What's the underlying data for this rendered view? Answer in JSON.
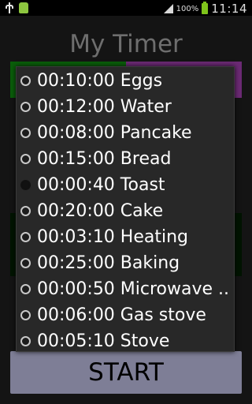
{
  "status_bar": {
    "battery": "100%",
    "time": "11:14"
  },
  "app": {
    "title": "My Timer",
    "start_label": "START"
  },
  "colors": {
    "tab_green": "#0a5e0a",
    "tab_purple": "#6b2a74",
    "start_button": "#7e7e96"
  },
  "dropdown": {
    "items": [
      {
        "label": "00:10:00 Eggs",
        "selected": false
      },
      {
        "label": "00:12:00 Water",
        "selected": false
      },
      {
        "label": "00:08:00 Pancake",
        "selected": false
      },
      {
        "label": "00:15:00 Bread",
        "selected": false
      },
      {
        "label": "00:00:40 Toast",
        "selected": true
      },
      {
        "label": "00:20:00 Cake",
        "selected": false
      },
      {
        "label": "00:03:10 Heating",
        "selected": false
      },
      {
        "label": "00:25:00 Baking",
        "selected": false
      },
      {
        "label": "00:00:50 Microwave ..",
        "selected": false
      },
      {
        "label": "00:06:00 Gas stove",
        "selected": false
      },
      {
        "label": "00:05:10 Stove",
        "selected": false
      }
    ]
  }
}
